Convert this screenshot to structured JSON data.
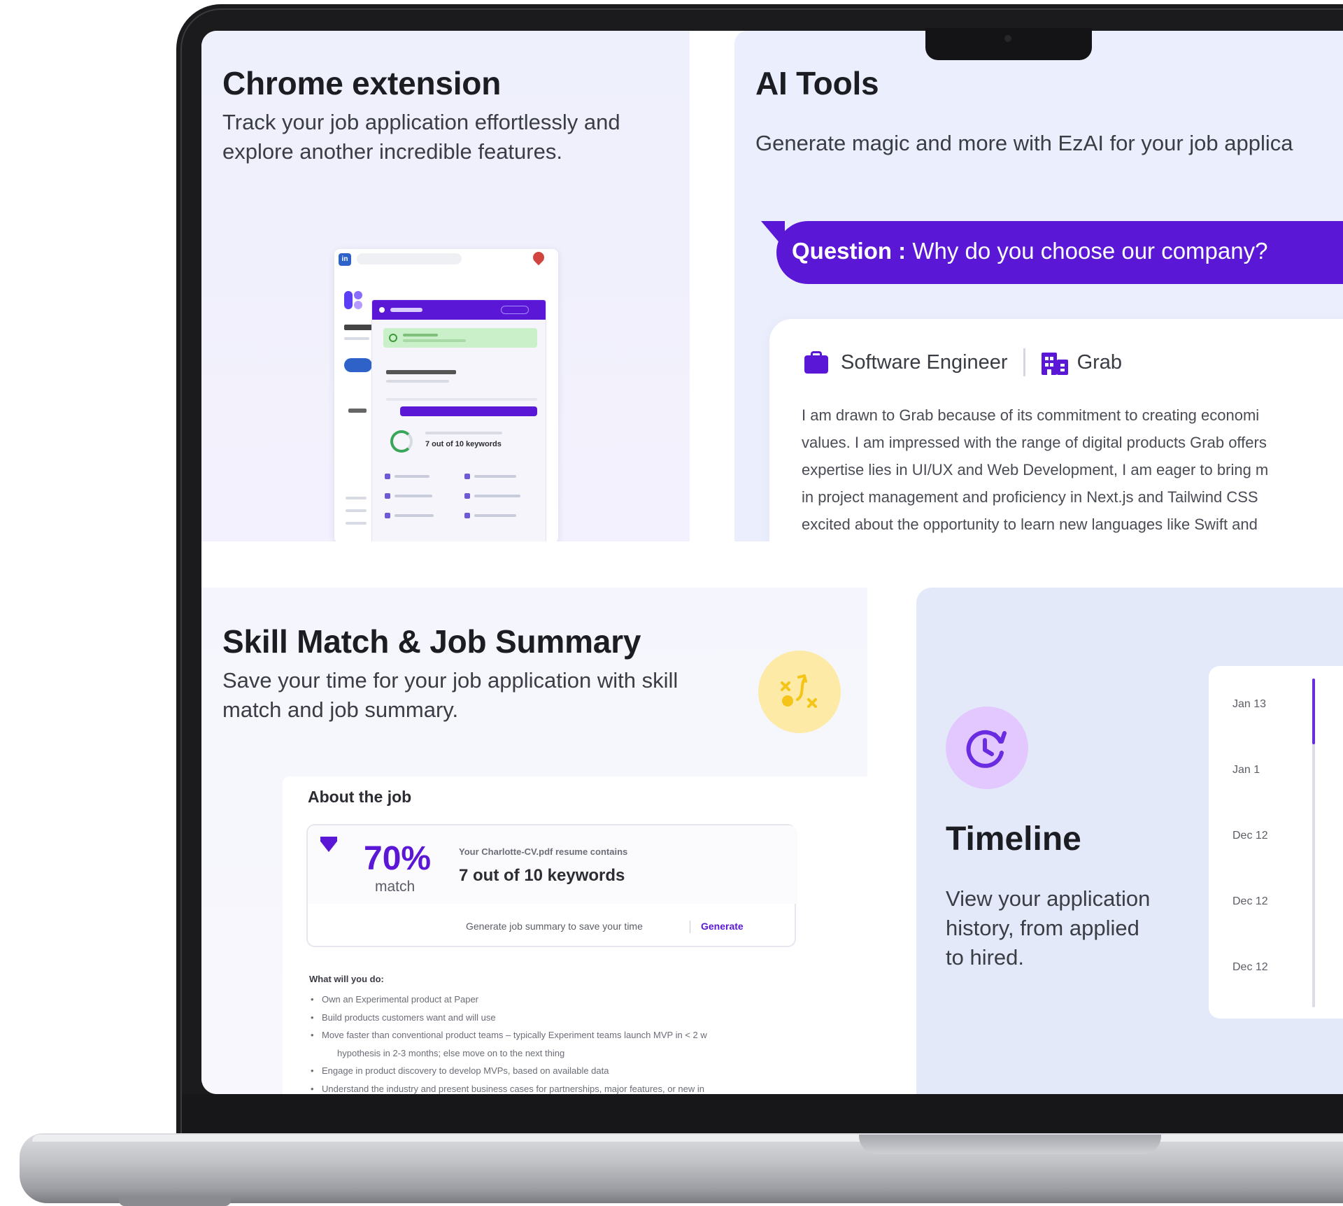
{
  "chrome_extension": {
    "title": "Chrome extension",
    "description_lines": [
      "Track your job application effortlessly and",
      "explore another incredible features."
    ],
    "mockup": {
      "kw_text": "7 out of 10 keywords"
    }
  },
  "ai_tools": {
    "title": "AI Tools",
    "description": "Generate magic and more with EzAI for your job applica",
    "question_label": "Question :",
    "question_text": "Why do you choose our company?",
    "job_role": "Software Engineer",
    "company": "Grab",
    "answer_lines": [
      "I am drawn to Grab because of its commitment to creating economi",
      "values. I am impressed with the range of digital products Grab offers",
      "expertise lies in UI/UX and Web Development, I am eager to bring m",
      "in project management and proficiency in Next.js and Tailwind CSS ",
      "excited about the opportunity to learn new languages like Swift and"
    ]
  },
  "skill_match": {
    "title": "Skill Match & Job Summary",
    "description_lines": [
      "Save your time for your job application with skill",
      "match and job summary."
    ],
    "about_title": "About the job",
    "match_percent": "70%",
    "match_label": "match",
    "resume_text": "Your Charlotte-CV.pdf resume contains",
    "keywords_text": "7 out of 10 keywords",
    "generate_hint": "Generate job summary to save your time",
    "generate_link": "Generate",
    "todo_title": "What will you do:",
    "todo_items": [
      "Own an Experimental product at Paper",
      "Build products customers want and will use",
      "Move faster than conventional product teams – typically Experiment teams launch MVP in < 2 w",
      "hypothesis in 2-3 months; else move on to the next thing",
      "Engage in product discovery to develop MVPs, based on available data",
      "Understand the industry and present business cases for partnerships, major features, or new in"
    ]
  },
  "timeline": {
    "title": "Timeline",
    "description_lines": [
      "View your application",
      "history, from applied",
      "to hired."
    ],
    "dates": [
      "Jan 13",
      "Jan 1",
      "Dec 12",
      "Dec 12",
      "Dec 12"
    ]
  },
  "colors": {
    "brand_purple": "#5a17d6",
    "skill_icon_bg": "#fdeaa6",
    "timeline_icon_bg": "#e2c8ff",
    "timeline_card_bg": "#e4e9fa"
  },
  "icons": {
    "briefcase": "briefcase-icon",
    "building": "building-icon",
    "strategy": "strategy-icon",
    "history": "history-clock-icon",
    "shield": "shield-icon"
  }
}
